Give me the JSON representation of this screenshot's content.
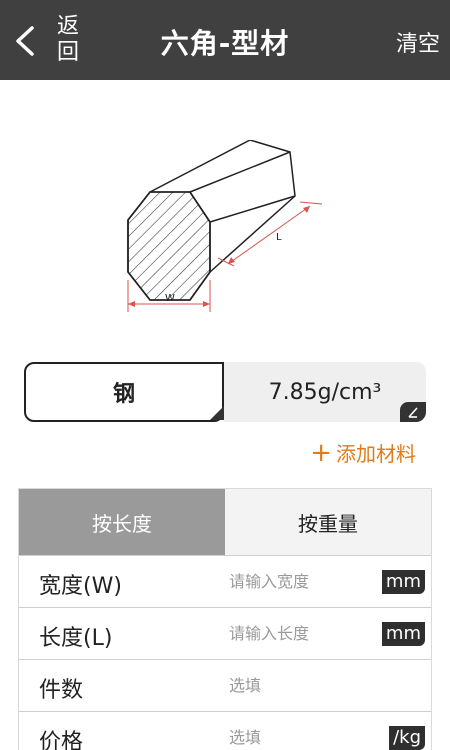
{
  "header": {
    "back_label": "返\n回",
    "title": "六角-型材",
    "clear_label": "清空"
  },
  "diagram": {
    "width_label": "W",
    "length_label": "L"
  },
  "material": {
    "name": "钢",
    "density": "7.85g/cm³"
  },
  "add_material_label": "添加材料",
  "tabs": [
    {
      "label": "按长度",
      "active": true
    },
    {
      "label": "按重量",
      "active": false
    }
  ],
  "fields": [
    {
      "label": "宽度(W)",
      "placeholder": "请输入宽度",
      "unit": "mm"
    },
    {
      "label": "长度(L)",
      "placeholder": "请输入长度",
      "unit": "mm"
    },
    {
      "label": "件数",
      "placeholder": "选填",
      "unit": ""
    },
    {
      "label": "价格",
      "placeholder": "选填",
      "unit": "/kg"
    }
  ],
  "colors": {
    "header_bg": "#404040",
    "accent_orange": "#e07b18",
    "dimension_red": "#d9534f",
    "active_tab": "#9a9a9a"
  }
}
